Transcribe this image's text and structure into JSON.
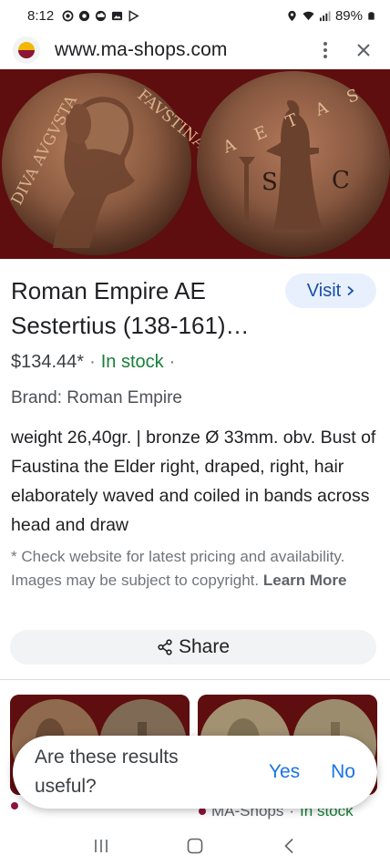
{
  "status_bar": {
    "time": "8:12",
    "battery": "89%",
    "left_icons": [
      "record-icon",
      "chrome-icon",
      "cloud-icon",
      "gallery-icon",
      "play-icon"
    ],
    "right_icons": [
      "location-icon",
      "wifi-icon",
      "signal-icon",
      "battery-icon"
    ]
  },
  "url_bar": {
    "url": "www.ma-shops.com",
    "favicon_colors": [
      "#8a1538",
      "#f2b705"
    ],
    "menu_icon": "more-vert-icon",
    "close_icon": "close-icon"
  },
  "product": {
    "title": "Roman Empire AE Sestertius (138-161)…",
    "visit_label": "Visit",
    "price": "$134.44*",
    "separator": "·",
    "stock": "In stock",
    "stock_separator": "·",
    "brand": "Brand: Roman Empire",
    "description": "weight 26,40gr. | bronze Ø 33mm. obv. Bust of Faustina the Elder right, draped, right, hair elaborately waved and coiled in bands across head and draw",
    "disclaimer": "* Check website for latest pricing and availability. Images may be subject to copyright.",
    "learn_more": "Learn More",
    "share_label": "Share"
  },
  "coin": {
    "obverse_legend_left": "DIVA AVGVSTA",
    "obverse_legend_right": "FAVSTINA",
    "reverse_legend": "AETAS",
    "reverse_s": "S",
    "reverse_c": "C"
  },
  "related": [
    {
      "source": "MA-Shops",
      "separator": "·",
      "stock": "In stock"
    }
  ],
  "feedback": {
    "question": "Are these results useful?",
    "yes": "Yes",
    "no": "No"
  },
  "colors": {
    "accent": "#1a73e8",
    "stock_green": "#188038",
    "hero_bg": "#5e0e0e"
  },
  "nav_bar": {
    "icons": [
      "recents-icon",
      "home-icon",
      "back-icon"
    ]
  }
}
